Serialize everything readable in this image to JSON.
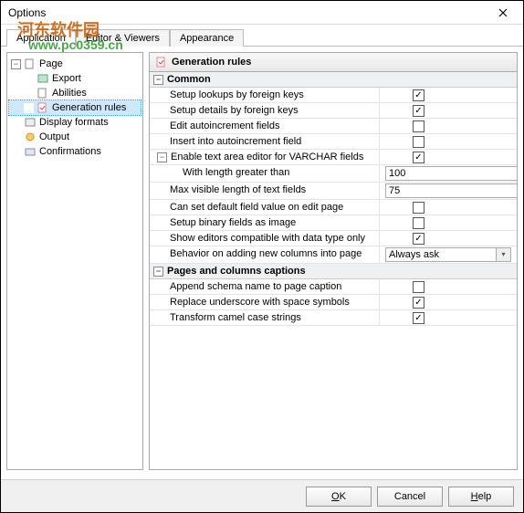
{
  "window": {
    "title": "Options"
  },
  "tabs": {
    "t0": "Application",
    "t1": "Editor & Viewers",
    "t2": "Appearance"
  },
  "tree": {
    "page": "Page",
    "export": "Export",
    "abilities": "Abilities",
    "genrules": "Generation rules",
    "display": "Display formats",
    "output": "Output",
    "confirm": "Confirmations"
  },
  "header": "Generation rules",
  "cat1": "Common",
  "rows": {
    "r1": "Setup lookups by foreign keys",
    "r2": "Setup details by foreign keys",
    "r3": "Edit autoincrement fields",
    "r4": "Insert into autoincrement field",
    "r5": "Enable text area editor for VARCHAR fields",
    "r6": "With length greater than",
    "r6v": "100",
    "r7": "Max visible length of text fields",
    "r7v": "75",
    "r8": "Can set default field value on edit page",
    "r9": "Setup binary fields as image",
    "r10": "Show editors compatible with data type only",
    "r11": "Behavior on adding new columns into page",
    "r11v": "Always ask"
  },
  "cat2": "Pages and columns captions",
  "rows2": {
    "p1": "Append schema name to page caption",
    "p2": "Replace underscore with space symbols",
    "p3": "Transform camel case strings"
  },
  "footer": {
    "ok": "OK",
    "cancel": "Cancel",
    "help": "Help"
  },
  "wm1": "河东软件园",
  "wm2": "www.pc0359.cn"
}
